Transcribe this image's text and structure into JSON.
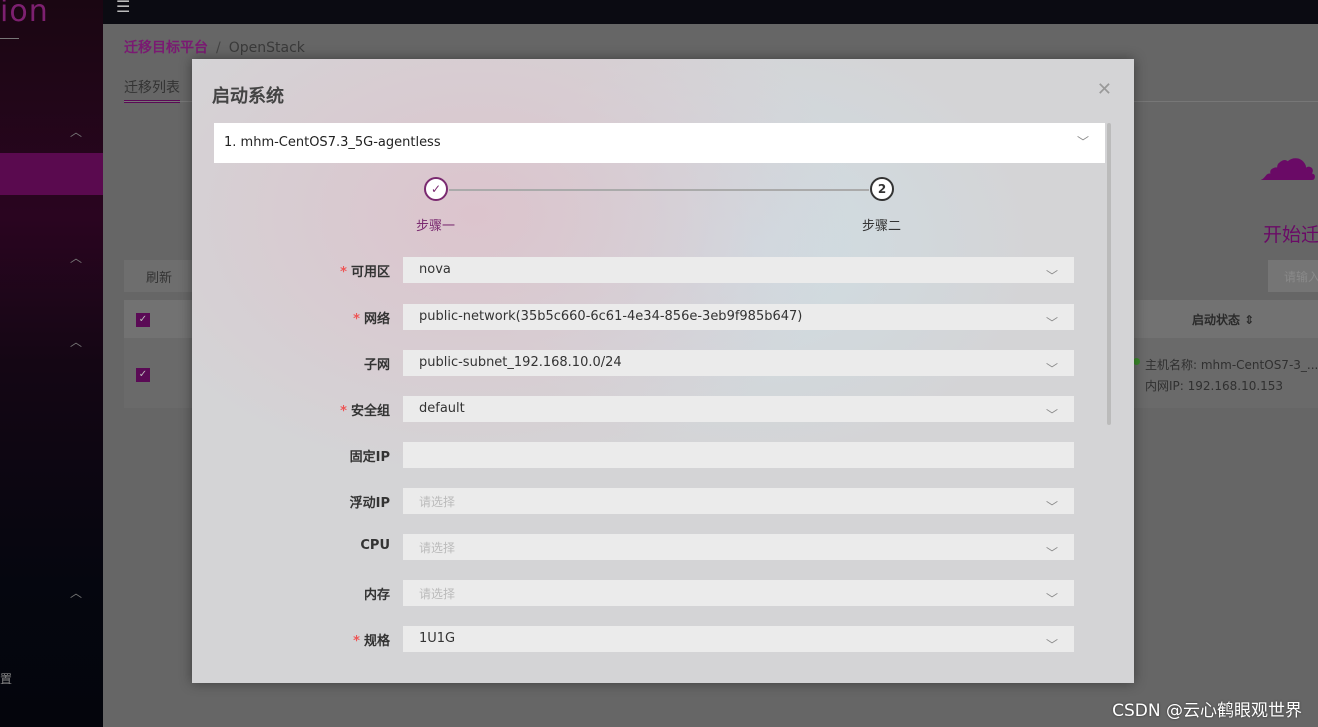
{
  "sidebar": {
    "logo": "ion",
    "bottom_text": "置"
  },
  "breadcrumb": {
    "parent": "迁移目标平台",
    "separator": "/",
    "current": "OpenStack"
  },
  "tabs": [
    {
      "label": "迁移列表"
    }
  ],
  "toolbar": {
    "refresh_label": "刷新"
  },
  "right_panel": {
    "start_label": "开始迁",
    "search_placeholder": "请输入"
  },
  "table": {
    "status_header": "启动状态",
    "row": {
      "name_partial": "m",
      "version_partial": "7.",
      "hostname": "主机名称: mhm-CentOS7-3_...",
      "ip": "内网IP: 192.168.10.153"
    }
  },
  "modal": {
    "title": "启动系统",
    "vm_select": "1. mhm-CentOS7.3_5G-agentless",
    "steps": [
      {
        "label": "步骤一",
        "status": "done"
      },
      {
        "label": "步骤二",
        "number": "2"
      }
    ],
    "fields": [
      {
        "label": "可用区",
        "required": true,
        "value": "nova"
      },
      {
        "label": "网络",
        "required": true,
        "value": "public-network(35b5c660-6c61-4e34-856e-3eb9f985b647)"
      },
      {
        "label": "子网",
        "required": false,
        "value": "public-subnet_192.168.10.0/24"
      },
      {
        "label": "安全组",
        "required": true,
        "value": "default"
      },
      {
        "label": "固定IP",
        "required": false,
        "value": ""
      },
      {
        "label": "浮动IP",
        "required": false,
        "placeholder": "请选择"
      },
      {
        "label": "CPU",
        "required": false,
        "placeholder": "请选择"
      },
      {
        "label": "内存",
        "required": false,
        "placeholder": "请选择"
      },
      {
        "label": "规格",
        "required": true,
        "value": "1U1G"
      }
    ]
  },
  "watermark": "CSDN @云心鹤眼观世界",
  "colors": {
    "accent": "#7a1a72",
    "required": "#ee5555"
  }
}
